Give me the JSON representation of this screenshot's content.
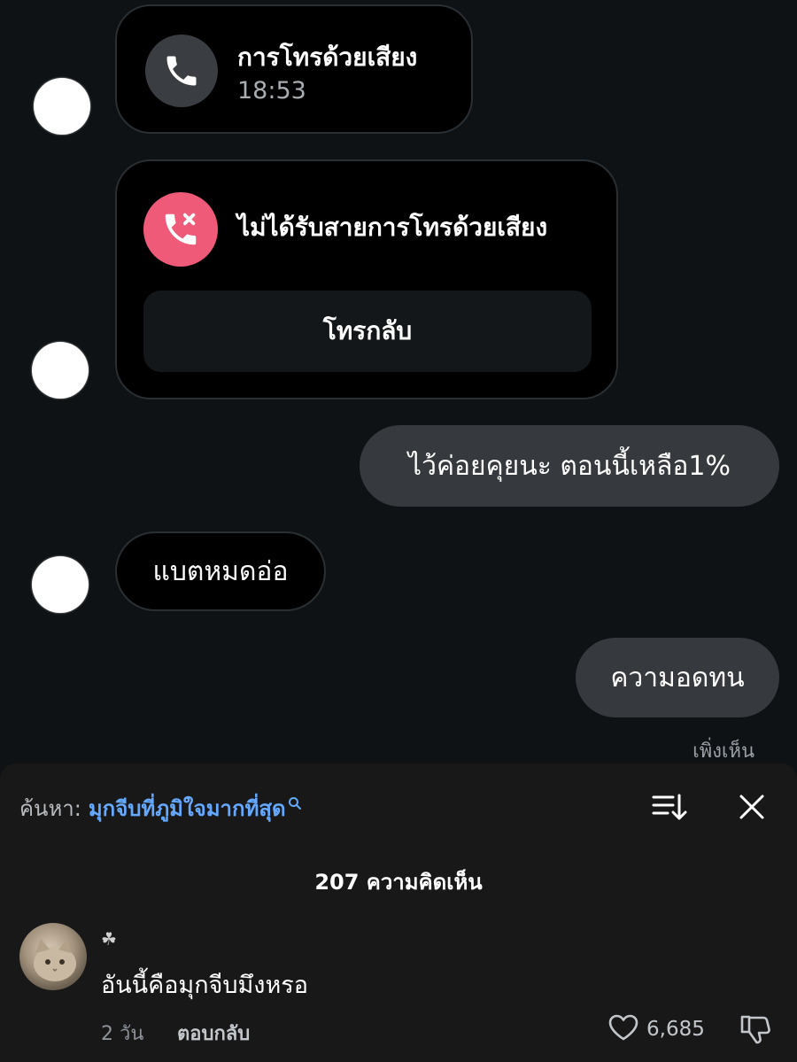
{
  "messages": {
    "voice_call": {
      "title": "การโทรด้วยเสียง",
      "time": "18:53"
    },
    "missed_call": {
      "title": "ไม่ได้รับสายการโทรด้วยเสียง",
      "callback_label": "โทรกลับ"
    },
    "sent_1": "ไว้ค่อยคุยนะ ตอนนี้เหลือ1%",
    "received_1": "แบตหมดอ่อ",
    "sent_2": "ความอดทน",
    "seen_label": "เพิ่งเห็น"
  },
  "comments_panel": {
    "search_prefix": "ค้นหา:",
    "search_query": "มุกจีบที่ภูมิใจมากที่สุด",
    "comment_count": "207 ความคิดเห็น",
    "comment": {
      "author": "☘",
      "text": "อันนี้คือมุกจีบมึงหรอ",
      "age": "2 วัน",
      "reply_label": "ตอบกลับ",
      "like_count": "6,685"
    }
  },
  "colors": {
    "background": "#0e1215",
    "panel": "#181818",
    "missed_call_accent": "#ef5a78",
    "search_link": "#64a8ff",
    "sent_bubble": "#36393d"
  },
  "icons": [
    "phone-icon",
    "missed-call-icon",
    "search-icon",
    "sort-icon",
    "close-icon",
    "heart-icon",
    "dislike-icon"
  ]
}
